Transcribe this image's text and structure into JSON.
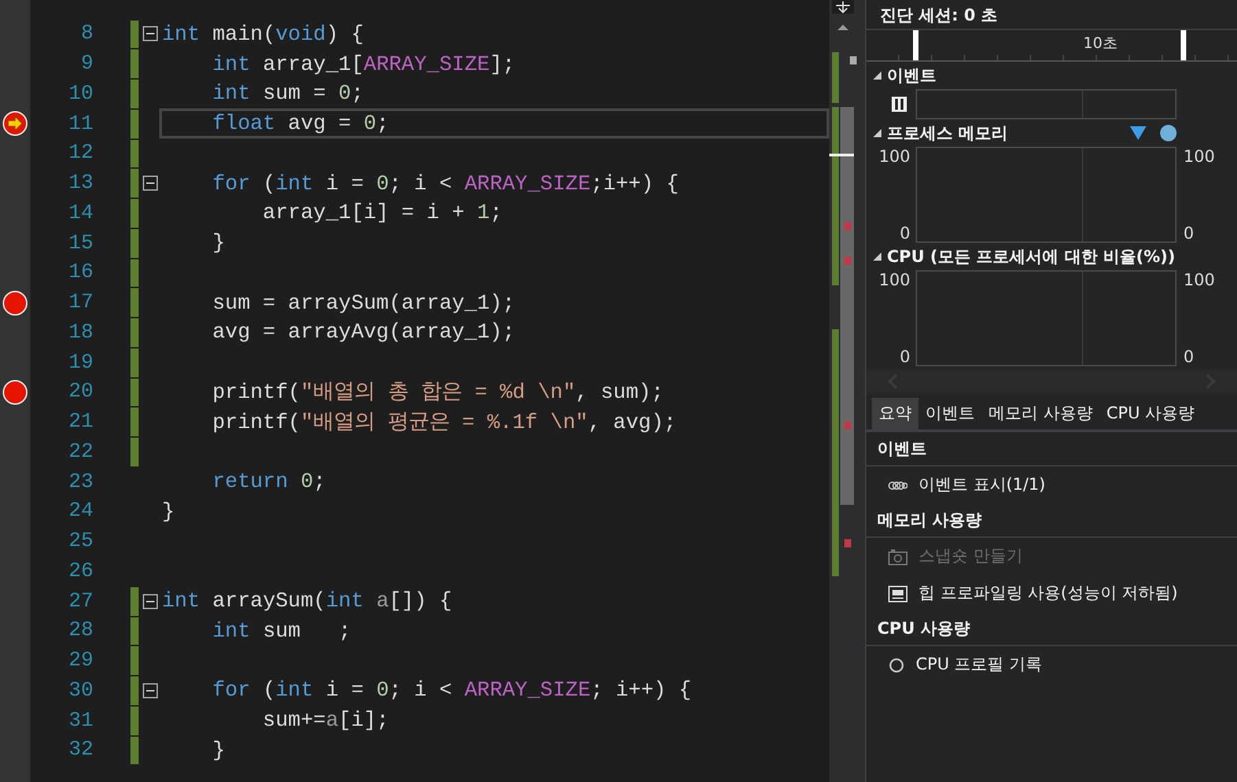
{
  "editor": {
    "lines": [
      {
        "number": "8",
        "changed": true,
        "fold": true,
        "breakpoint": false,
        "current": false,
        "tokens": [
          {
            "kind": "kw",
            "text": "int"
          },
          {
            "kind": "plain",
            "text": " main("
          },
          {
            "kind": "kw",
            "text": "void"
          },
          {
            "kind": "plain",
            "text": ") {"
          }
        ]
      },
      {
        "number": "9",
        "changed": true,
        "fold": false,
        "breakpoint": false,
        "current": false,
        "tokens": [
          {
            "kind": "kw",
            "text": "    int"
          },
          {
            "kind": "plain",
            "text": " array_1["
          },
          {
            "kind": "macro",
            "text": "ARRAY_SIZE"
          },
          {
            "kind": "plain",
            "text": "];"
          }
        ]
      },
      {
        "number": "10",
        "changed": true,
        "fold": false,
        "breakpoint": false,
        "current": false,
        "tokens": [
          {
            "kind": "kw",
            "text": "    int"
          },
          {
            "kind": "plain",
            "text": " sum = "
          },
          {
            "kind": "num",
            "text": "0"
          },
          {
            "kind": "plain",
            "text": ";"
          }
        ]
      },
      {
        "number": "11",
        "changed": true,
        "fold": false,
        "breakpoint": true,
        "current": true,
        "tokens": [
          {
            "kind": "kw",
            "text": "    float"
          },
          {
            "kind": "plain",
            "text": " avg = "
          },
          {
            "kind": "num",
            "text": "0"
          },
          {
            "kind": "plain",
            "text": ";"
          }
        ]
      },
      {
        "number": "12",
        "changed": true,
        "fold": false,
        "breakpoint": false,
        "current": false
      },
      {
        "number": "13",
        "changed": true,
        "fold": true,
        "breakpoint": false,
        "current": false,
        "tokens": [
          {
            "kind": "kw",
            "text": "    for"
          },
          {
            "kind": "plain",
            "text": " ("
          },
          {
            "kind": "kw",
            "text": "int"
          },
          {
            "kind": "plain",
            "text": " i = "
          },
          {
            "kind": "num",
            "text": "0"
          },
          {
            "kind": "plain",
            "text": "; i < "
          },
          {
            "kind": "macro",
            "text": "ARRAY_SIZE"
          },
          {
            "kind": "plain",
            "text": ";i++) {"
          }
        ]
      },
      {
        "number": "14",
        "changed": true,
        "fold": false,
        "breakpoint": false,
        "current": false,
        "tokens": [
          {
            "kind": "plain",
            "text": "        array_1[i] = i + "
          },
          {
            "kind": "num",
            "text": "1"
          },
          {
            "kind": "plain",
            "text": ";"
          }
        ]
      },
      {
        "number": "15",
        "changed": true,
        "fold": false,
        "breakpoint": false,
        "current": false,
        "tokens": [
          {
            "kind": "plain",
            "text": "    }"
          }
        ]
      },
      {
        "number": "16",
        "changed": true,
        "fold": false,
        "breakpoint": false,
        "current": false
      },
      {
        "number": "17",
        "changed": true,
        "fold": false,
        "breakpoint": true,
        "current": false,
        "tokens": [
          {
            "kind": "plain",
            "text": "    sum = arraySum(array_1);"
          }
        ]
      },
      {
        "number": "18",
        "changed": true,
        "fold": false,
        "breakpoint": false,
        "current": false,
        "tokens": [
          {
            "kind": "plain",
            "text": "    avg = arrayAvg(array_1);"
          }
        ]
      },
      {
        "number": "19",
        "changed": true,
        "fold": false,
        "breakpoint": false,
        "current": false
      },
      {
        "number": "20",
        "changed": true,
        "fold": false,
        "breakpoint": true,
        "current": false,
        "tokens": [
          {
            "kind": "plain",
            "text": "    printf("
          },
          {
            "kind": "str",
            "text": "\"배열의 총 합은 = %d \\n\""
          },
          {
            "kind": "plain",
            "text": ", sum);"
          }
        ]
      },
      {
        "number": "21",
        "changed": true,
        "fold": false,
        "breakpoint": false,
        "current": false,
        "tokens": [
          {
            "kind": "plain",
            "text": "    printf("
          },
          {
            "kind": "str",
            "text": "\"배열의 평균은 = %.1f \\n\""
          },
          {
            "kind": "plain",
            "text": ", avg);"
          }
        ]
      },
      {
        "number": "22",
        "changed": true,
        "fold": false,
        "breakpoint": false,
        "current": false
      },
      {
        "number": "23",
        "changed": false,
        "fold": false,
        "breakpoint": false,
        "current": false,
        "tokens": [
          {
            "kind": "kw",
            "text": "    return "
          },
          {
            "kind": "num",
            "text": "0"
          },
          {
            "kind": "plain",
            "text": ";"
          }
        ]
      },
      {
        "number": "24",
        "changed": false,
        "fold": false,
        "breakpoint": false,
        "current": false,
        "tokens": [
          {
            "kind": "plain",
            "text": "}"
          }
        ]
      },
      {
        "number": "25",
        "changed": false,
        "fold": false,
        "breakpoint": false,
        "current": false
      },
      {
        "number": "26",
        "changed": false,
        "fold": false,
        "breakpoint": false,
        "current": false
      },
      {
        "number": "27",
        "changed": true,
        "fold": true,
        "breakpoint": false,
        "current": false,
        "tokens": [
          {
            "kind": "kw",
            "text": "int"
          },
          {
            "kind": "plain",
            "text": " arraySum("
          },
          {
            "kind": "kw",
            "text": "int "
          },
          {
            "kind": "param",
            "text": "a"
          },
          {
            "kind": "plain",
            "text": "[]) {"
          }
        ]
      },
      {
        "number": "28",
        "changed": true,
        "fold": false,
        "breakpoint": false,
        "current": false,
        "tokens": [
          {
            "kind": "kw",
            "text": "    int"
          },
          {
            "kind": "plain",
            "text": " sum   ;"
          }
        ]
      },
      {
        "number": "29",
        "changed": true,
        "fold": false,
        "breakpoint": false,
        "current": false
      },
      {
        "number": "30",
        "changed": true,
        "fold": true,
        "breakpoint": false,
        "current": false,
        "tokens": [
          {
            "kind": "kw",
            "text": "    for"
          },
          {
            "kind": "plain",
            "text": " ("
          },
          {
            "kind": "kw",
            "text": "int"
          },
          {
            "kind": "plain",
            "text": " i = "
          },
          {
            "kind": "num",
            "text": "0"
          },
          {
            "kind": "plain",
            "text": "; i < "
          },
          {
            "kind": "macro",
            "text": "ARRAY_SIZE"
          },
          {
            "kind": "plain",
            "text": "; i++) {"
          }
        ]
      },
      {
        "number": "31",
        "changed": true,
        "fold": false,
        "breakpoint": false,
        "current": false,
        "tokens": [
          {
            "kind": "plain",
            "text": "        sum+="
          },
          {
            "kind": "param",
            "text": "a"
          },
          {
            "kind": "plain",
            "text": "[i];"
          }
        ]
      },
      {
        "number": "32",
        "changed": true,
        "fold": false,
        "breakpoint": false,
        "current": false,
        "tokens": [
          {
            "kind": "plain",
            "text": "    }"
          }
        ]
      }
    ]
  },
  "diagnostics": {
    "session_title": "진단 세션: 0 초",
    "timeline_label": "10초",
    "sections": [
      {
        "kind": "events",
        "title": "이벤트"
      },
      {
        "kind": "chart",
        "title": "프로세스 메모리",
        "legend": true,
        "left_max": "100",
        "left_min": "0",
        "right_max": "100",
        "right_min": "0"
      },
      {
        "kind": "chart",
        "title": "CPU (모든 프로세서에 대한 비율(%))",
        "legend": false,
        "left_max": "100",
        "left_min": "0",
        "right_max": "100",
        "right_min": "0"
      }
    ],
    "tabs": [
      {
        "label": "요약",
        "selected": true
      },
      {
        "label": "이벤트",
        "selected": false
      },
      {
        "label": "메모리 사용량",
        "selected": false
      },
      {
        "label": "CPU 사용량",
        "selected": false
      }
    ],
    "groups": [
      {
        "title": "이벤트",
        "items": [
          {
            "kind": "events",
            "label": "이벤트 표시(1/1)",
            "disabled": false
          }
        ]
      },
      {
        "title": "메모리 사용량",
        "items": [
          {
            "kind": "snapshot",
            "label": "스냅숏 만들기",
            "disabled": true
          },
          {
            "kind": "heap",
            "label": "힙 프로파일링 사용(성능이 저하됨)",
            "disabled": false
          }
        ]
      },
      {
        "title": "CPU 사용량",
        "items": [
          {
            "kind": "record",
            "label": "CPU 프로필 기록",
            "disabled": false
          }
        ]
      }
    ]
  }
}
